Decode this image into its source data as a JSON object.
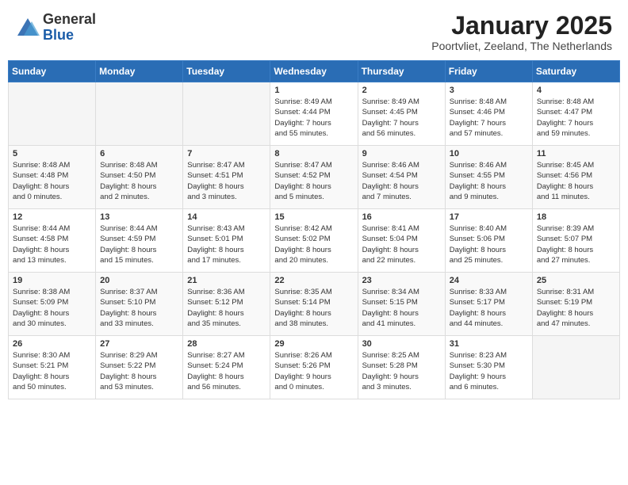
{
  "header": {
    "logo": {
      "general": "General",
      "blue": "Blue"
    },
    "title": "January 2025",
    "subtitle": "Poortvliet, Zeeland, The Netherlands"
  },
  "weekdays": [
    "Sunday",
    "Monday",
    "Tuesday",
    "Wednesday",
    "Thursday",
    "Friday",
    "Saturday"
  ],
  "weeks": [
    {
      "days": [
        {
          "number": "",
          "info": ""
        },
        {
          "number": "",
          "info": ""
        },
        {
          "number": "",
          "info": ""
        },
        {
          "number": "1",
          "info": "Sunrise: 8:49 AM\nSunset: 4:44 PM\nDaylight: 7 hours\nand 55 minutes."
        },
        {
          "number": "2",
          "info": "Sunrise: 8:49 AM\nSunset: 4:45 PM\nDaylight: 7 hours\nand 56 minutes."
        },
        {
          "number": "3",
          "info": "Sunrise: 8:48 AM\nSunset: 4:46 PM\nDaylight: 7 hours\nand 57 minutes."
        },
        {
          "number": "4",
          "info": "Sunrise: 8:48 AM\nSunset: 4:47 PM\nDaylight: 7 hours\nand 59 minutes."
        }
      ]
    },
    {
      "days": [
        {
          "number": "5",
          "info": "Sunrise: 8:48 AM\nSunset: 4:48 PM\nDaylight: 8 hours\nand 0 minutes."
        },
        {
          "number": "6",
          "info": "Sunrise: 8:48 AM\nSunset: 4:50 PM\nDaylight: 8 hours\nand 2 minutes."
        },
        {
          "number": "7",
          "info": "Sunrise: 8:47 AM\nSunset: 4:51 PM\nDaylight: 8 hours\nand 3 minutes."
        },
        {
          "number": "8",
          "info": "Sunrise: 8:47 AM\nSunset: 4:52 PM\nDaylight: 8 hours\nand 5 minutes."
        },
        {
          "number": "9",
          "info": "Sunrise: 8:46 AM\nSunset: 4:54 PM\nDaylight: 8 hours\nand 7 minutes."
        },
        {
          "number": "10",
          "info": "Sunrise: 8:46 AM\nSunset: 4:55 PM\nDaylight: 8 hours\nand 9 minutes."
        },
        {
          "number": "11",
          "info": "Sunrise: 8:45 AM\nSunset: 4:56 PM\nDaylight: 8 hours\nand 11 minutes."
        }
      ]
    },
    {
      "days": [
        {
          "number": "12",
          "info": "Sunrise: 8:44 AM\nSunset: 4:58 PM\nDaylight: 8 hours\nand 13 minutes."
        },
        {
          "number": "13",
          "info": "Sunrise: 8:44 AM\nSunset: 4:59 PM\nDaylight: 8 hours\nand 15 minutes."
        },
        {
          "number": "14",
          "info": "Sunrise: 8:43 AM\nSunset: 5:01 PM\nDaylight: 8 hours\nand 17 minutes."
        },
        {
          "number": "15",
          "info": "Sunrise: 8:42 AM\nSunset: 5:02 PM\nDaylight: 8 hours\nand 20 minutes."
        },
        {
          "number": "16",
          "info": "Sunrise: 8:41 AM\nSunset: 5:04 PM\nDaylight: 8 hours\nand 22 minutes."
        },
        {
          "number": "17",
          "info": "Sunrise: 8:40 AM\nSunset: 5:06 PM\nDaylight: 8 hours\nand 25 minutes."
        },
        {
          "number": "18",
          "info": "Sunrise: 8:39 AM\nSunset: 5:07 PM\nDaylight: 8 hours\nand 27 minutes."
        }
      ]
    },
    {
      "days": [
        {
          "number": "19",
          "info": "Sunrise: 8:38 AM\nSunset: 5:09 PM\nDaylight: 8 hours\nand 30 minutes."
        },
        {
          "number": "20",
          "info": "Sunrise: 8:37 AM\nSunset: 5:10 PM\nDaylight: 8 hours\nand 33 minutes."
        },
        {
          "number": "21",
          "info": "Sunrise: 8:36 AM\nSunset: 5:12 PM\nDaylight: 8 hours\nand 35 minutes."
        },
        {
          "number": "22",
          "info": "Sunrise: 8:35 AM\nSunset: 5:14 PM\nDaylight: 8 hours\nand 38 minutes."
        },
        {
          "number": "23",
          "info": "Sunrise: 8:34 AM\nSunset: 5:15 PM\nDaylight: 8 hours\nand 41 minutes."
        },
        {
          "number": "24",
          "info": "Sunrise: 8:33 AM\nSunset: 5:17 PM\nDaylight: 8 hours\nand 44 minutes."
        },
        {
          "number": "25",
          "info": "Sunrise: 8:31 AM\nSunset: 5:19 PM\nDaylight: 8 hours\nand 47 minutes."
        }
      ]
    },
    {
      "days": [
        {
          "number": "26",
          "info": "Sunrise: 8:30 AM\nSunset: 5:21 PM\nDaylight: 8 hours\nand 50 minutes."
        },
        {
          "number": "27",
          "info": "Sunrise: 8:29 AM\nSunset: 5:22 PM\nDaylight: 8 hours\nand 53 minutes."
        },
        {
          "number": "28",
          "info": "Sunrise: 8:27 AM\nSunset: 5:24 PM\nDaylight: 8 hours\nand 56 minutes."
        },
        {
          "number": "29",
          "info": "Sunrise: 8:26 AM\nSunset: 5:26 PM\nDaylight: 9 hours\nand 0 minutes."
        },
        {
          "number": "30",
          "info": "Sunrise: 8:25 AM\nSunset: 5:28 PM\nDaylight: 9 hours\nand 3 minutes."
        },
        {
          "number": "31",
          "info": "Sunrise: 8:23 AM\nSunset: 5:30 PM\nDaylight: 9 hours\nand 6 minutes."
        },
        {
          "number": "",
          "info": ""
        }
      ]
    }
  ]
}
